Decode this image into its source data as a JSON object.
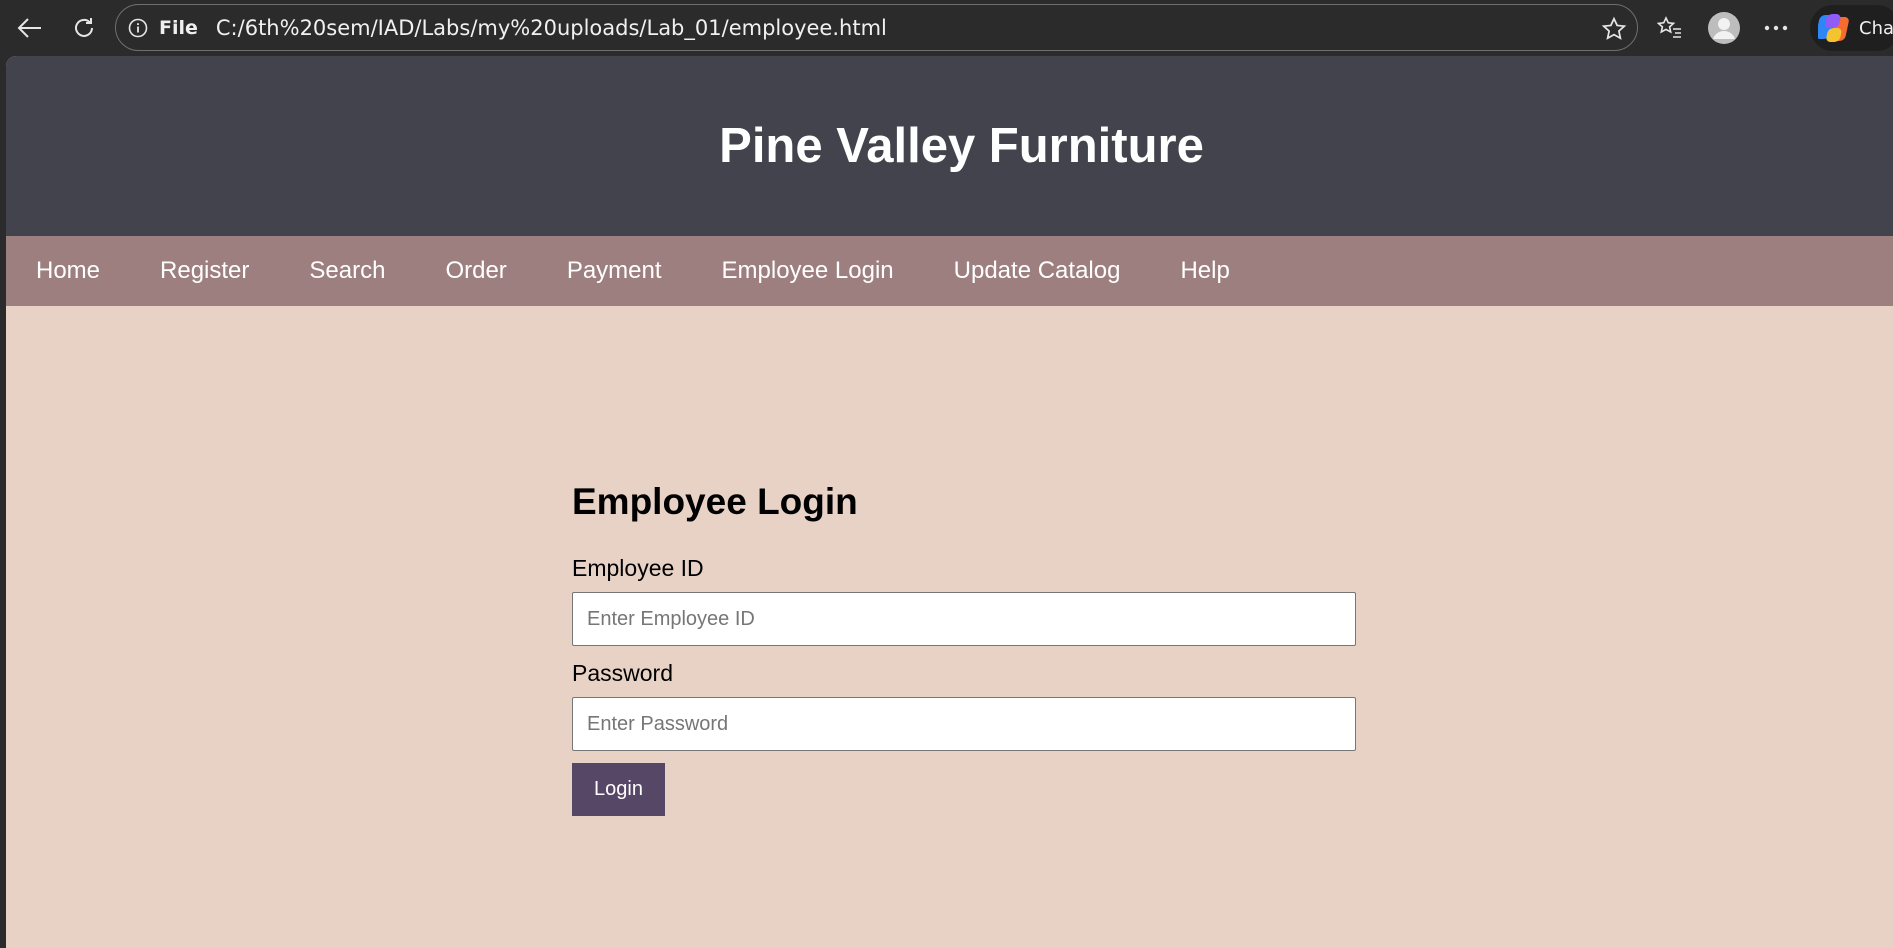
{
  "browser": {
    "address_scheme": "File",
    "url": "C:/6th%20sem/IAD/Labs/my%20uploads/Lab_01/employee.html",
    "copilot_label": "Cha"
  },
  "site": {
    "title": "Pine Valley Furniture",
    "nav": [
      "Home",
      "Register",
      "Search",
      "Order",
      "Payment",
      "Employee Login",
      "Update Catalog",
      "Help"
    ]
  },
  "login": {
    "heading": "Employee Login",
    "employee_id_label": "Employee ID",
    "employee_id_placeholder": "Enter Employee ID",
    "password_label": "Password",
    "password_placeholder": "Enter Password",
    "submit_label": "Login"
  },
  "colors": {
    "header_bg": "#43434d",
    "nav_bg": "#9e7f7f",
    "page_bg": "#e8d2c6",
    "button_bg": "#574766"
  }
}
